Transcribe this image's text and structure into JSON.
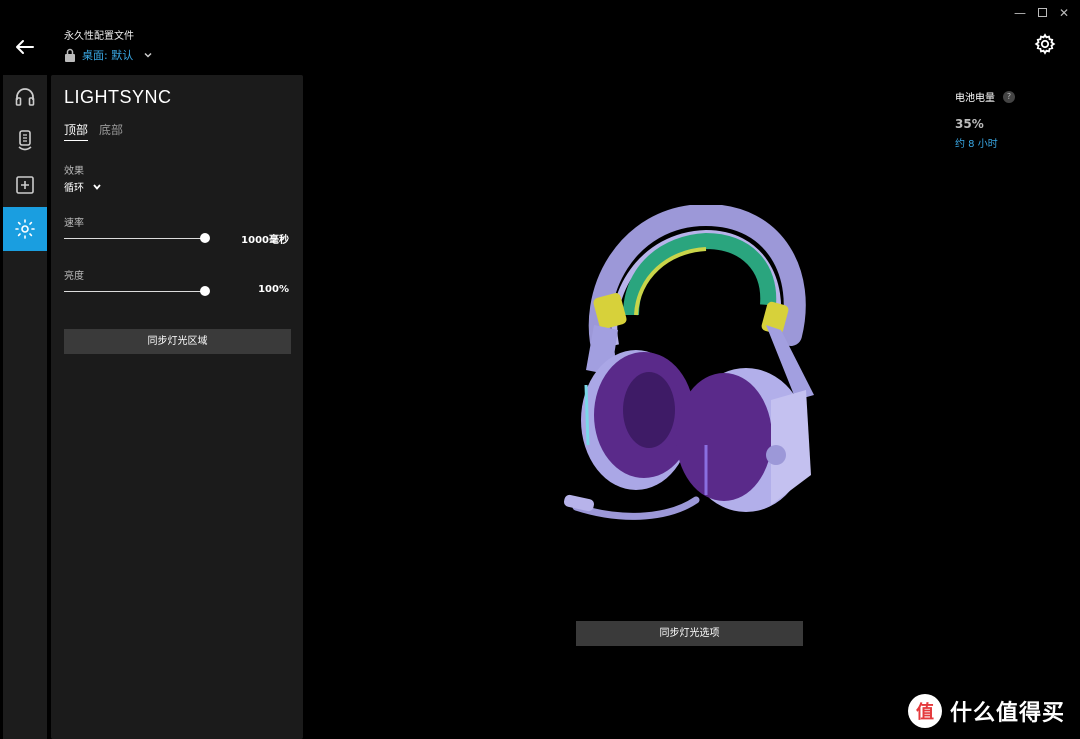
{
  "window": {
    "minimize_glyph": "—",
    "close_glyph": "✕"
  },
  "header": {
    "profile_title": "永久性配置文件",
    "profile_name": "桌面: 默认"
  },
  "rail": {
    "items": [
      {
        "icon": "headphones-icon",
        "active": false
      },
      {
        "icon": "device-battery-icon",
        "active": false
      },
      {
        "icon": "add-square-icon",
        "active": false
      },
      {
        "icon": "lightsync-icon",
        "active": true
      }
    ],
    "accent": "#1a9ee0"
  },
  "panel": {
    "title": "LIGHTSYNC",
    "tabs": [
      "顶部",
      "底部"
    ],
    "effect_label": "效果",
    "effect_value": "循环",
    "speed_label": "速率",
    "speed_value": "1000毫秒",
    "speed_level": 1.0,
    "brightness_label": "亮度",
    "brightness_value": "100%",
    "brightness_level": 1.0,
    "sync_zones_button": "同步灯光区域"
  },
  "main": {
    "sync_options_button": "同步灯光选项"
  },
  "battery": {
    "label": "电池电量",
    "help": "?",
    "percent": "35%",
    "time": "约 8 小时"
  },
  "watermark": {
    "logo_text": "值",
    "text": "什么值得买"
  }
}
